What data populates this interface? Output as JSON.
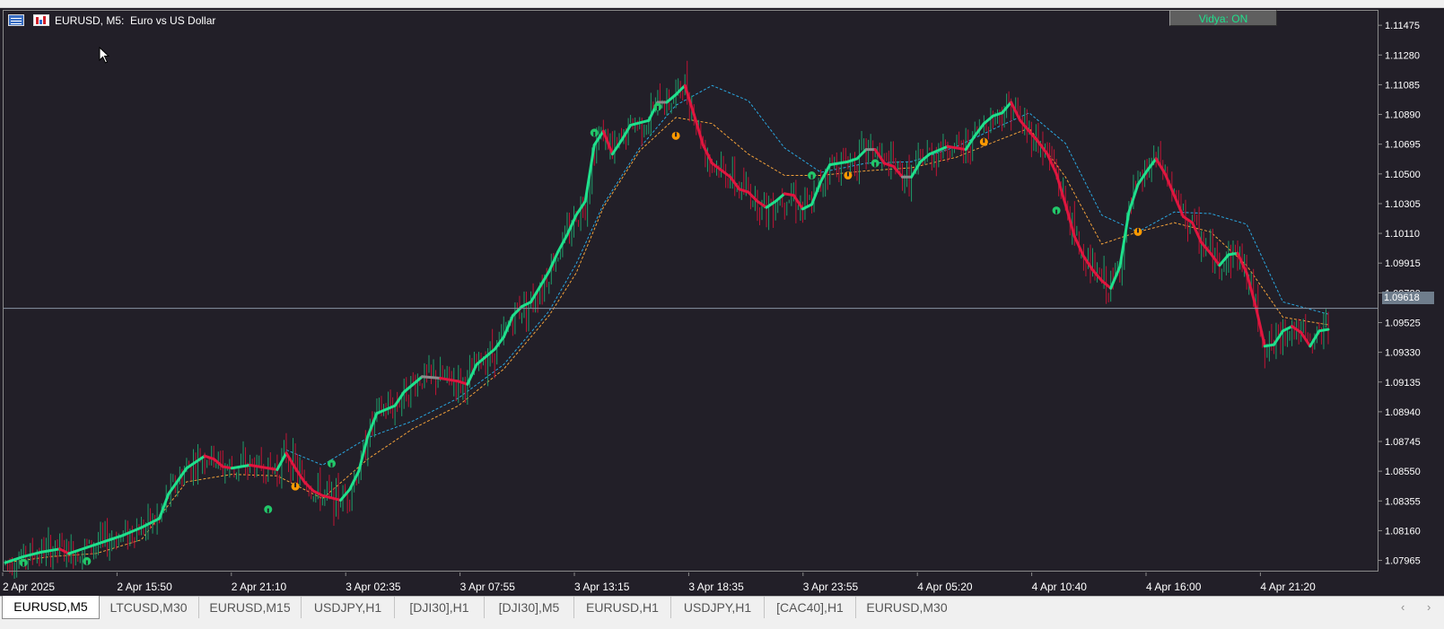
{
  "window": {
    "title": "EURUSD, M5:  Euro vs US Dollar",
    "button_label": "Vidya: ON",
    "current_price": "1.09618"
  },
  "icons": [
    "list-view-icon",
    "chart-bars-icon",
    "mouse-pointer-icon",
    "scroll-left-icon",
    "scroll-right-icon"
  ],
  "colors": {
    "background": "#221f28",
    "bull_candle": "#1f9d6a",
    "bear_candle": "#c01535",
    "vidya_up": "#1fe08c",
    "vidya_down": "#e0163f",
    "vidya_flat": "#8a8a8a",
    "band_upper": "#2aa7e0",
    "band_lower": "#f2a13a",
    "buy_signal": "#22c86a",
    "sell_signal": "#ff9a00"
  },
  "chart_data": {
    "type": "candlestick",
    "symbol": "EURUSD",
    "timeframe": "M5",
    "ylim": [
      1.0788,
      1.1157
    ],
    "y_ticks": [
      "1.11475",
      "1.11280",
      "1.11085",
      "1.10890",
      "1.10695",
      "1.10500",
      "1.10305",
      "1.10110",
      "1.09915",
      "1.09720",
      "1.09525",
      "1.09330",
      "1.09135",
      "1.08940",
      "1.08745",
      "1.08550",
      "1.08355",
      "1.08160",
      "1.07965"
    ],
    "x_ticks": [
      "2 Apr 2025",
      "2 Apr 15:50",
      "2 Apr 21:10",
      "3 Apr 02:35",
      "3 Apr 07:55",
      "3 Apr 13:15",
      "3 Apr 18:35",
      "3 Apr 23:55",
      "4 Apr 05:20",
      "4 Apr 10:40",
      "4 Apr 16:00",
      "4 Apr 21:20"
    ],
    "last_price": 1.09618,
    "vidya_line": [
      [
        0,
        1.0795
      ],
      [
        2,
        1.0799
      ],
      [
        4,
        1.0802
      ],
      [
        6,
        1.0804
      ],
      [
        7,
        1.0801
      ],
      [
        9,
        1.0805
      ],
      [
        11,
        1.0809
      ],
      [
        13,
        1.0813
      ],
      [
        15,
        1.0818
      ],
      [
        17,
        1.0824
      ],
      [
        18,
        1.084
      ],
      [
        20,
        1.0857
      ],
      [
        22,
        1.0865
      ],
      [
        23,
        1.0863
      ],
      [
        24,
        1.0858
      ],
      [
        25,
        1.0857
      ],
      [
        27,
        1.0859
      ],
      [
        29,
        1.0857
      ],
      [
        30,
        1.0856
      ],
      [
        31,
        1.0867
      ],
      [
        32,
        1.0857
      ],
      [
        33,
        1.0848
      ],
      [
        34,
        1.0842
      ],
      [
        35,
        1.0839
      ],
      [
        37,
        1.0836
      ],
      [
        38,
        1.0843
      ],
      [
        39,
        1.0855
      ],
      [
        40,
        1.0878
      ],
      [
        41,
        1.0893
      ],
      [
        43,
        1.0898
      ],
      [
        44,
        1.0907
      ],
      [
        45,
        1.0912
      ],
      [
        46,
        1.0917
      ],
      [
        48,
        1.0916
      ],
      [
        50,
        1.0914
      ],
      [
        51,
        1.0912
      ],
      [
        52,
        1.0925
      ],
      [
        54,
        1.0935
      ],
      [
        55,
        1.0943
      ],
      [
        56,
        1.0957
      ],
      [
        57,
        1.0963
      ],
      [
        58,
        1.0966
      ],
      [
        60,
        1.0986
      ],
      [
        61,
        1.0999
      ],
      [
        62,
        1.101
      ],
      [
        63,
        1.1023
      ],
      [
        64,
        1.1032
      ],
      [
        65,
        1.1069
      ],
      [
        66,
        1.1078
      ],
      [
        67,
        1.1063
      ],
      [
        68,
        1.1072
      ],
      [
        69,
        1.1082
      ],
      [
        71,
        1.1085
      ],
      [
        72,
        1.1097
      ],
      [
        73,
        1.1097
      ],
      [
        74,
        1.1102
      ],
      [
        75,
        1.1108
      ],
      [
        76,
        1.1089
      ],
      [
        77,
        1.1069
      ],
      [
        78,
        1.1057
      ],
      [
        80,
        1.1048
      ],
      [
        81,
        1.104
      ],
      [
        82,
        1.1038
      ],
      [
        83,
        1.1032
      ],
      [
        84,
        1.1028
      ],
      [
        85,
        1.1032
      ],
      [
        86,
        1.1037
      ],
      [
        87,
        1.1036
      ],
      [
        88,
        1.1027
      ],
      [
        89,
        1.103
      ],
      [
        90,
        1.1045
      ],
      [
        91,
        1.1056
      ],
      [
        93,
        1.1058
      ],
      [
        94,
        1.106
      ],
      [
        95,
        1.1066
      ],
      [
        96,
        1.1066
      ],
      [
        97,
        1.1057
      ],
      [
        98,
        1.1055
      ],
      [
        99,
        1.1048
      ],
      [
        100,
        1.1048
      ],
      [
        101,
        1.1058
      ],
      [
        102,
        1.1063
      ],
      [
        104,
        1.1068
      ],
      [
        105,
        1.1067
      ],
      [
        106,
        1.1066
      ],
      [
        107,
        1.1075
      ],
      [
        108,
        1.1083
      ],
      [
        109,
        1.1088
      ],
      [
        110,
        1.109
      ],
      [
        111,
        1.1097
      ],
      [
        112,
        1.1085
      ],
      [
        113,
        1.1078
      ],
      [
        114,
        1.1071
      ],
      [
        115,
        1.1063
      ],
      [
        116,
        1.105
      ],
      [
        117,
        1.103
      ],
      [
        118,
        1.1009
      ],
      [
        119,
        1.0996
      ],
      [
        120,
        1.0987
      ],
      [
        121,
        1.098
      ],
      [
        122,
        1.0975
      ],
      [
        123,
        1.0989
      ],
      [
        124,
        1.1025
      ],
      [
        125,
        1.1043
      ],
      [
        126,
        1.1052
      ],
      [
        127,
        1.106
      ],
      [
        128,
        1.105
      ],
      [
        129,
        1.1036
      ],
      [
        130,
        1.1022
      ],
      [
        131,
        1.1018
      ],
      [
        132,
        1.1005
      ],
      [
        133,
        1.0998
      ],
      [
        134,
        1.099
      ],
      [
        135,
        1.0997
      ],
      [
        136,
        1.0998
      ],
      [
        137,
        1.0985
      ],
      [
        138,
        1.0963
      ],
      [
        139,
        1.0937
      ],
      [
        140,
        1.0938
      ],
      [
        141,
        1.0947
      ],
      [
        142,
        1.095
      ],
      [
        143,
        1.0946
      ],
      [
        144,
        1.0937
      ],
      [
        145,
        1.0947
      ],
      [
        146,
        1.0948
      ]
    ],
    "band_upper": [
      [
        31,
        1.0869
      ],
      [
        35,
        1.0859
      ],
      [
        40,
        1.0877
      ],
      [
        45,
        1.0888
      ],
      [
        50,
        1.0903
      ],
      [
        55,
        1.0925
      ],
      [
        60,
        1.096
      ],
      [
        63,
        1.0991
      ],
      [
        66,
        1.103
      ],
      [
        70,
        1.1067
      ],
      [
        74,
        1.1095
      ],
      [
        78,
        1.1108
      ],
      [
        82,
        1.1098
      ],
      [
        86,
        1.1067
      ],
      [
        90,
        1.1051
      ],
      [
        95,
        1.1057
      ],
      [
        100,
        1.1058
      ],
      [
        105,
        1.1068
      ],
      [
        110,
        1.1082
      ],
      [
        113,
        1.109
      ],
      [
        117,
        1.107
      ],
      [
        121,
        1.1023
      ],
      [
        125,
        1.1012
      ],
      [
        129,
        1.1025
      ],
      [
        133,
        1.1024
      ],
      [
        137,
        1.1017
      ],
      [
        141,
        1.0966
      ],
      [
        146,
        1.0958
      ]
    ],
    "band_lower": [
      [
        0,
        1.0795
      ],
      [
        5,
        1.0799
      ],
      [
        10,
        1.0801
      ],
      [
        15,
        1.081
      ],
      [
        20,
        1.0848
      ],
      [
        25,
        1.0853
      ],
      [
        30,
        1.0852
      ],
      [
        35,
        1.0837
      ],
      [
        40,
        1.0863
      ],
      [
        45,
        1.0883
      ],
      [
        50,
        1.0898
      ],
      [
        55,
        1.0922
      ],
      [
        60,
        1.0957
      ],
      [
        63,
        1.0985
      ],
      [
        66,
        1.1028
      ],
      [
        70,
        1.1065
      ],
      [
        74,
        1.1087
      ],
      [
        78,
        1.1083
      ],
      [
        82,
        1.1063
      ],
      [
        86,
        1.1049
      ],
      [
        90,
        1.1049
      ],
      [
        95,
        1.1052
      ],
      [
        100,
        1.1054
      ],
      [
        105,
        1.1061
      ],
      [
        110,
        1.1073
      ],
      [
        113,
        1.108
      ],
      [
        117,
        1.1048
      ],
      [
        121,
        1.1004
      ],
      [
        125,
        1.1012
      ],
      [
        129,
        1.1018
      ],
      [
        133,
        1.1012
      ],
      [
        137,
        1.099
      ],
      [
        141,
        1.0956
      ],
      [
        146,
        1.0951
      ]
    ],
    "buy_signals": [
      [
        2,
        1.0795
      ],
      [
        9,
        1.0796
      ],
      [
        29,
        1.083
      ],
      [
        36,
        1.086
      ],
      [
        65,
        1.1077
      ],
      [
        72,
        1.1094
      ],
      [
        89,
        1.1049
      ],
      [
        96,
        1.1057
      ],
      [
        116,
        1.1026
      ]
    ],
    "sell_signals": [
      [
        32,
        1.0845
      ],
      [
        74,
        1.1075
      ],
      [
        93,
        1.1049
      ],
      [
        108,
        1.1071
      ],
      [
        125,
        1.1012
      ]
    ]
  },
  "tabs": [
    {
      "label": "EURUSD,M5",
      "active": true
    },
    {
      "label": "LTCUSD,M30"
    },
    {
      "label": "EURUSD,M15"
    },
    {
      "label": "USDJPY,H1"
    },
    {
      "label": "[DJI30],H1"
    },
    {
      "label": "[DJI30],M5"
    },
    {
      "label": "EURUSD,H1"
    },
    {
      "label": "USDJPY,H1"
    },
    {
      "label": "[CAC40],H1"
    },
    {
      "label": "EURUSD,M30"
    }
  ]
}
